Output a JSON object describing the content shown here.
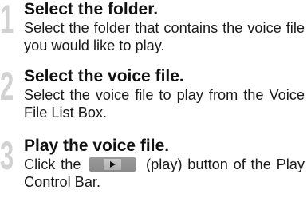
{
  "steps": [
    {
      "number": "1",
      "title": "Select the folder.",
      "body": "Select the folder that contains the voice file you would like to play."
    },
    {
      "number": "2",
      "title": "Select the voice file.",
      "body": "Select the voice file to play from the Voice File List Box."
    },
    {
      "number": "3",
      "title": "Play the voice file.",
      "body_before": "Click the",
      "button_icon": "play-icon",
      "body_after": "(play) button of the Play Control Bar."
    }
  ]
}
